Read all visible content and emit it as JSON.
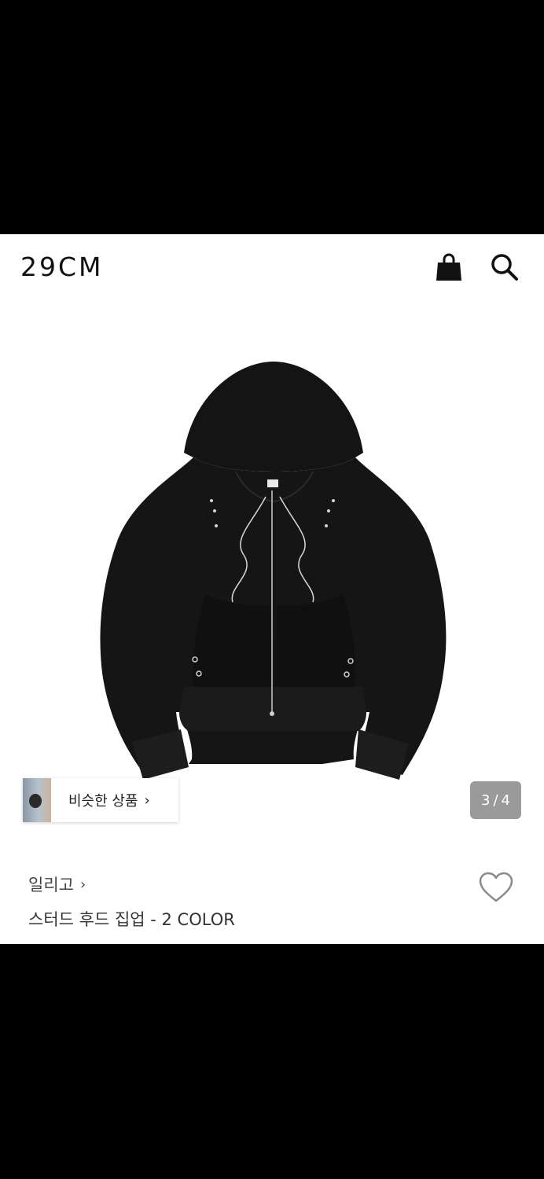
{
  "app": {
    "logo": "29CM"
  },
  "header": {
    "cart_icon": "shopping-bag-icon",
    "search_icon": "search-icon"
  },
  "gallery": {
    "current": 3,
    "total": 4,
    "separator": "/",
    "similar_label": "비슷한 상품",
    "similar_chevron": "›"
  },
  "product": {
    "brand": "일리고",
    "brand_chevron": "›",
    "title": "스터드 후드 집업 - 2 COLOR",
    "wishlist_icon": "heart-outline-icon"
  },
  "colors": {
    "background": "#ffffff",
    "garment": "#121212",
    "text_primary": "#222222",
    "pager_bg": "#9a9a9a"
  }
}
